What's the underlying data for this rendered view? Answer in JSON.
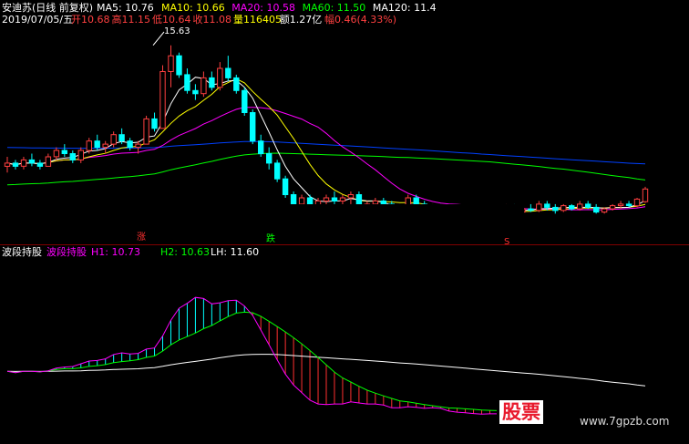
{
  "header": {
    "stock_title": "安迪苏(日线 前复权)",
    "ma": [
      {
        "label": "MA5: 10.76",
        "color": "#ffffff"
      },
      {
        "label": "MA10: 10.66",
        "color": "#ffff00"
      },
      {
        "label": "MA20: 10.58",
        "color": "#ff00ff"
      },
      {
        "label": "MA60: 11.50",
        "color": "#00ff00"
      },
      {
        "label": "MA120: 11.4",
        "color": "#ffffff"
      }
    ],
    "date": "2019/07/05/五",
    "ohlc": [
      {
        "label": "开10.68",
        "color": "#ff4040"
      },
      {
        "label": "高11.15",
        "color": "#ff4040"
      },
      {
        "label": "低10.64",
        "color": "#ff4040"
      },
      {
        "label": "收11.08",
        "color": "#ff4040"
      },
      {
        "label": "量116405",
        "color": "#ffff00"
      },
      {
        "label": "额1.27亿",
        "color": "#ffffff"
      },
      {
        "label": "幅0.46(4.33%)",
        "color": "#ff4040"
      }
    ]
  },
  "indicator": {
    "name": "波段持股",
    "name_colored": "波段持股",
    "h1": "H1: 10.73",
    "h2": "H2: 10.63",
    "lh": "LH: 11.60"
  },
  "price_labels": {
    "peak": "15.63"
  },
  "signals": [
    {
      "text": "涨",
      "color": "#ff3030"
    },
    {
      "text": "跌",
      "color": "#00ff00"
    },
    {
      "text": "S",
      "color": "#ff3030"
    }
  ],
  "watermark": {
    "logo": "股票",
    "url": "www.7gpzb.com"
  },
  "colors": {
    "up": "#ff4040",
    "down": "#00ffff",
    "ma5": "#ffffff",
    "ma10": "#ffff00",
    "ma20": "#ff00ff",
    "ma60": "#00ff00",
    "ma120": "#0040ff",
    "h1_up": "#ff00ff",
    "h1_down": "#ff00ff",
    "h2": "#00ff00",
    "lh": "#ffffff",
    "fill_up": "#00ffff",
    "fill_down": "#ff3030",
    "separator": "#800000"
  },
  "chart_data": {
    "type": "line",
    "title": "安迪苏(日线 前复权)",
    "price_range": [
      9.5,
      16.2
    ],
    "candles": [
      [
        11.8,
        12.1,
        11.6,
        11.9
      ],
      [
        11.9,
        12.0,
        11.7,
        11.8
      ],
      [
        11.8,
        12.1,
        11.7,
        12.0
      ],
      [
        12.0,
        12.2,
        11.8,
        11.9
      ],
      [
        11.9,
        12.0,
        11.7,
        11.8
      ],
      [
        11.8,
        12.2,
        11.8,
        12.1
      ],
      [
        12.1,
        12.4,
        12.0,
        12.3
      ],
      [
        12.3,
        12.5,
        12.1,
        12.2
      ],
      [
        12.2,
        12.3,
        11.9,
        12.0
      ],
      [
        12.0,
        12.4,
        11.9,
        12.3
      ],
      [
        12.3,
        12.7,
        12.2,
        12.6
      ],
      [
        12.6,
        12.8,
        12.3,
        12.4
      ],
      [
        12.4,
        12.6,
        12.2,
        12.5
      ],
      [
        12.5,
        12.9,
        12.4,
        12.8
      ],
      [
        12.8,
        13.0,
        12.5,
        12.6
      ],
      [
        12.6,
        12.7,
        12.3,
        12.4
      ],
      [
        12.4,
        12.6,
        12.2,
        12.5
      ],
      [
        12.5,
        13.4,
        12.5,
        13.3
      ],
      [
        13.3,
        13.5,
        12.9,
        13.0
      ],
      [
        13.0,
        15.0,
        13.0,
        14.8
      ],
      [
        14.8,
        15.63,
        14.3,
        15.3
      ],
      [
        15.3,
        15.4,
        14.6,
        14.7
      ],
      [
        14.7,
        14.9,
        14.1,
        14.2
      ],
      [
        14.2,
        14.4,
        13.9,
        14.1
      ],
      [
        14.1,
        14.8,
        14.0,
        14.6
      ],
      [
        14.6,
        14.8,
        14.2,
        14.3
      ],
      [
        14.3,
        15.1,
        14.2,
        14.9
      ],
      [
        14.9,
        15.3,
        14.5,
        14.6
      ],
      [
        14.6,
        14.7,
        14.1,
        14.2
      ],
      [
        14.2,
        14.3,
        13.4,
        13.5
      ],
      [
        13.5,
        13.6,
        12.5,
        12.6
      ],
      [
        12.6,
        12.8,
        12.1,
        12.2
      ],
      [
        12.2,
        12.4,
        11.7,
        11.9
      ],
      [
        11.9,
        12.0,
        11.3,
        11.4
      ],
      [
        11.4,
        11.5,
        10.8,
        10.9
      ],
      [
        10.9,
        11.0,
        10.5,
        10.6
      ],
      [
        10.6,
        10.9,
        10.5,
        10.8
      ],
      [
        10.8,
        10.9,
        10.4,
        10.5
      ],
      [
        10.5,
        10.8,
        10.4,
        10.7
      ],
      [
        10.7,
        10.9,
        10.5,
        10.8
      ],
      [
        10.8,
        11.0,
        10.6,
        10.7
      ],
      [
        10.7,
        10.9,
        10.5,
        10.8
      ],
      [
        10.8,
        11.0,
        10.6,
        10.9
      ],
      [
        10.9,
        11.0,
        10.4,
        10.5
      ],
      [
        10.5,
        10.7,
        10.4,
        10.6
      ],
      [
        10.6,
        10.8,
        10.5,
        10.7
      ],
      [
        10.7,
        10.8,
        10.5,
        10.6
      ],
      [
        10.6,
        10.7,
        10.3,
        10.4
      ],
      [
        10.4,
        10.6,
        10.3,
        10.5
      ],
      [
        10.5,
        10.9,
        10.4,
        10.8
      ],
      [
        10.8,
        10.9,
        10.5,
        10.6
      ],
      [
        10.6,
        10.7,
        10.3,
        10.4
      ],
      [
        10.4,
        10.6,
        10.3,
        10.5
      ],
      [
        10.5,
        10.6,
        10.3,
        10.4
      ],
      [
        10.4,
        10.5,
        10.2,
        10.3
      ],
      [
        10.3,
        10.5,
        10.2,
        10.4
      ],
      [
        10.4,
        10.5,
        10.2,
        10.3
      ],
      [
        10.3,
        10.4,
        10.2,
        10.35
      ],
      [
        10.35,
        10.5,
        10.2,
        10.3
      ],
      [
        10.3,
        10.4,
        10.2,
        10.35
      ],
      [
        10.35,
        10.5,
        10.25,
        10.4
      ],
      [
        10.4,
        10.6,
        10.3,
        10.45
      ],
      [
        10.45,
        10.6,
        10.3,
        10.35
      ],
      [
        10.35,
        10.5,
        10.25,
        10.45
      ],
      [
        10.45,
        10.6,
        10.35,
        10.4
      ],
      [
        10.4,
        10.7,
        10.35,
        10.6
      ],
      [
        10.6,
        10.7,
        10.4,
        10.5
      ],
      [
        10.5,
        10.6,
        10.3,
        10.4
      ],
      [
        10.4,
        10.6,
        10.35,
        10.55
      ],
      [
        10.55,
        10.6,
        10.4,
        10.45
      ],
      [
        10.45,
        10.7,
        10.4,
        10.6
      ],
      [
        10.6,
        10.7,
        10.45,
        10.5
      ],
      [
        10.5,
        10.6,
        10.3,
        10.35
      ],
      [
        10.35,
        10.5,
        10.3,
        10.45
      ],
      [
        10.45,
        10.6,
        10.4,
        10.55
      ],
      [
        10.55,
        10.7,
        10.45,
        10.6
      ],
      [
        10.6,
        10.7,
        10.5,
        10.55
      ],
      [
        10.55,
        10.8,
        10.5,
        10.76
      ],
      [
        10.68,
        11.15,
        10.64,
        11.08
      ]
    ],
    "series": [
      {
        "key": "ma5"
      },
      {
        "key": "ma10"
      },
      {
        "key": "ma20"
      },
      {
        "key": "ma60"
      },
      {
        "key": "ma120"
      }
    ],
    "indicator_range": [
      9.8,
      16.0
    ]
  }
}
